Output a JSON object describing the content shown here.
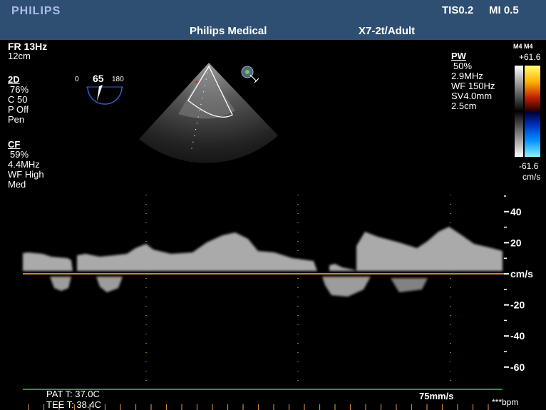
{
  "header": {
    "logo": "PHILIPS",
    "tis": "TIS0.2",
    "mi": "MI 0.5",
    "institution": "Philips Medical",
    "probe": "X7-2t/Adult"
  },
  "left_params": {
    "fr": "FR 13Hz",
    "depth": "12cm",
    "twod": {
      "heading": "2D",
      "gain": "76%",
      "compression": "C 50",
      "persistence": "P Off",
      "mode": "Pen"
    },
    "cf": {
      "heading": "CF",
      "gain": "59%",
      "freq": "4.4MHz",
      "wall_filter": "WF High",
      "priority": "Med"
    }
  },
  "angle_indicator": {
    "min": "0",
    "value": "65",
    "max": "180"
  },
  "pw_params": {
    "heading": "PW",
    "gain": "50%",
    "freq": "2.9MHz",
    "wall_filter": "WF 150Hz",
    "sample_volume": "SV4.0mm",
    "depth": "2.5cm"
  },
  "color_map": {
    "label": "M4 M4",
    "max": "+61.6",
    "min": "-61.6",
    "unit": "cm/s"
  },
  "velocity_scale": {
    "ticks": [
      {
        "value": 40,
        "label": "40"
      },
      {
        "value": 20,
        "label": "20"
      },
      {
        "value": 0,
        "label": "cm/s"
      },
      {
        "value": -20,
        "label": "-20"
      },
      {
        "value": -40,
        "label": "-40"
      },
      {
        "value": -60,
        "label": "-60"
      }
    ]
  },
  "bottom": {
    "pat_temp": "PAT T: 37.0C",
    "tee_temp": "TEE T: 38.4C",
    "sweep_speed": "75mm/s",
    "heart_rate": "***bpm"
  },
  "colors": {
    "header_bg": "#2f4f72",
    "baseline": "#c8843c",
    "ecg": "#3cc83c",
    "marker": "#c8843c"
  }
}
